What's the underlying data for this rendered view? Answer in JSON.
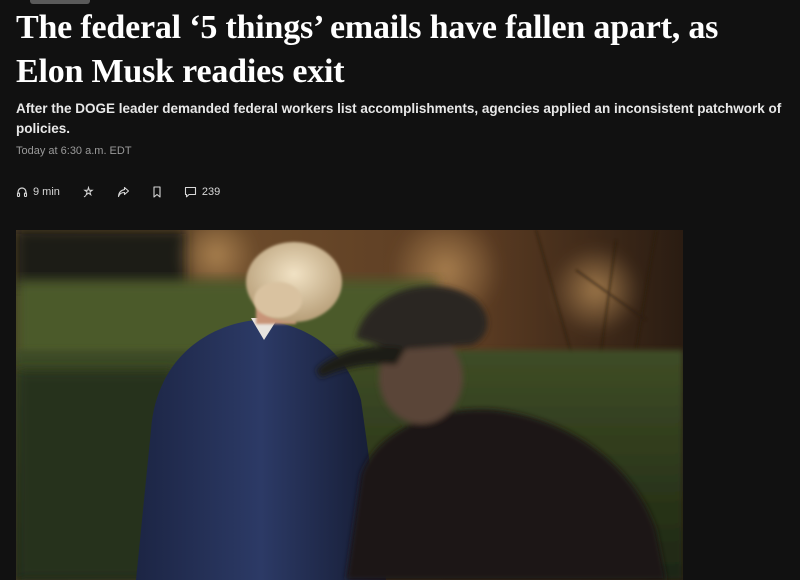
{
  "article": {
    "headline_line1": "The federal ‘5 things’ emails have fallen apart, as",
    "headline_line2": "Elon Musk readies exit",
    "subhead_line1": "After the DOGE leader demanded federal workers list accomplishments, agencies applied an inconsistent patchwork of",
    "subhead_line2": "policies.",
    "timestamp": "Today at 6:30 a.m. EDT"
  },
  "toolbar": {
    "listen_label": "9 min",
    "comments_count": "239",
    "icons": [
      "headphones-icon",
      "gift-icon",
      "share-icon",
      "bookmark-icon",
      "comment-icon"
    ]
  },
  "photo": {
    "description_icon": "lead-photo"
  }
}
